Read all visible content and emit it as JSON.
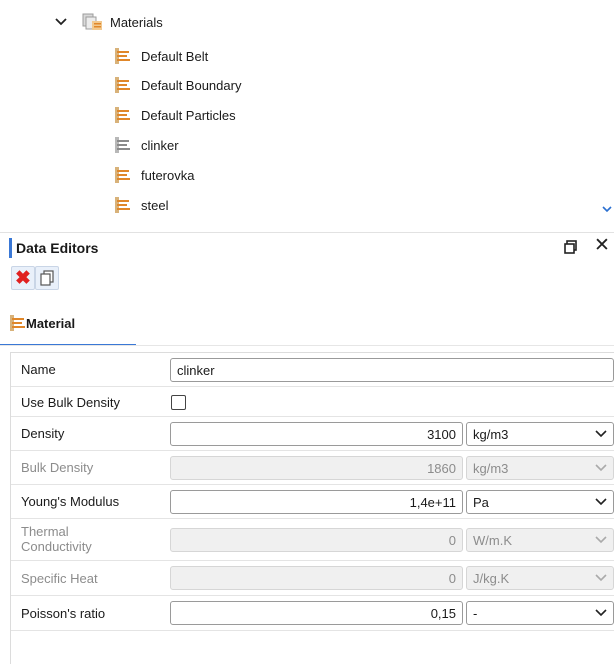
{
  "tree": {
    "root_label": "Materials",
    "items": [
      {
        "label": "Default Belt",
        "icon": "material-icon"
      },
      {
        "label": "Default Boundary",
        "icon": "material-icon"
      },
      {
        "label": "Default Particles",
        "icon": "material-icon"
      },
      {
        "label": "clinker",
        "icon": "material-icon-selected"
      },
      {
        "label": "futerovka",
        "icon": "material-icon"
      },
      {
        "label": "steel",
        "icon": "material-icon"
      }
    ]
  },
  "panel": {
    "title": "Data Editors",
    "tab_label": "Material"
  },
  "colors": {
    "accent": "#3a78d6",
    "material_icon": "#e0872a",
    "delete": "#e02020"
  },
  "properties": {
    "name": {
      "label": "Name",
      "value": "clinker"
    },
    "use_bulk_density": {
      "label": "Use Bulk Density",
      "checked": false
    },
    "density": {
      "label": "Density",
      "value": "3100",
      "unit": "kg/m3"
    },
    "bulk_density": {
      "label": "Bulk Density",
      "value": "1860",
      "unit": "kg/m3"
    },
    "youngs_modulus": {
      "label": "Young's Modulus",
      "value": "1,4e+11",
      "unit": "Pa"
    },
    "thermal_conductivity": {
      "label_line1": "Thermal",
      "label_line2": "Conductivity",
      "value": "0",
      "unit": "W/m.K"
    },
    "specific_heat": {
      "label": "Specific Heat",
      "value": "0",
      "unit": "J/kg.K"
    },
    "poissons_ratio": {
      "label": "Poisson's ratio",
      "value": "0,15",
      "unit": "-"
    }
  }
}
